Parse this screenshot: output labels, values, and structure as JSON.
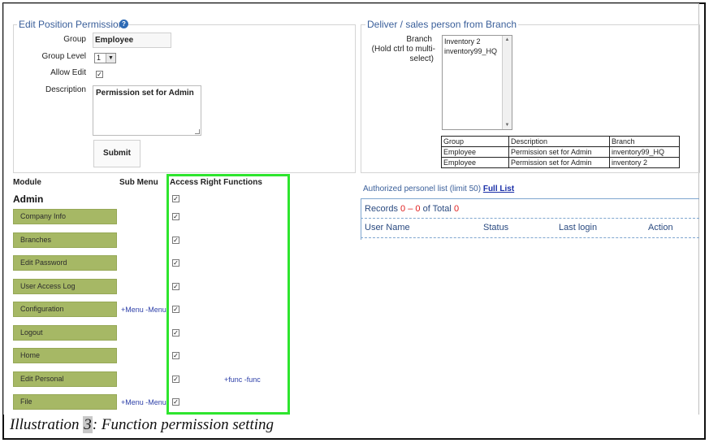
{
  "edit_position": {
    "title": "Edit Position Permission",
    "group_label": "Group",
    "group_value": "Employee",
    "group_level_label": "Group Level",
    "group_level_value": "1",
    "allow_edit_label": "Allow Edit",
    "allow_edit_checked": "✓",
    "description_label": "Description",
    "description_value": "Permission set for Admin",
    "submit_label": "Submit"
  },
  "deliver": {
    "title": "Deliver / sales person from Branch",
    "branch_label_1": "Branch",
    "branch_label_2": "(Hold ctrl to multi-",
    "branch_label_3": "select)",
    "branch_options": [
      "Inventory 2",
      "inventory99_HQ"
    ],
    "table": {
      "headers": [
        "Group",
        "Description",
        "Branch"
      ],
      "rows": [
        [
          "Employee",
          "Permission set for Admin",
          "inventory99_HQ"
        ],
        [
          "Employee",
          "Permission set for Admin",
          "inventory 2"
        ]
      ]
    }
  },
  "modules": {
    "module_header": "Module",
    "submenu_header": "Sub Menu",
    "access_header": "Access Right Functions",
    "group_name": "Admin",
    "check": "✓",
    "items": [
      {
        "label": "Company Info"
      },
      {
        "label": "Branches"
      },
      {
        "label": "Edit Password"
      },
      {
        "label": "User Access Log"
      },
      {
        "label": "Configuration",
        "submenu": "+Menu  -Menu"
      },
      {
        "label": "Logout"
      },
      {
        "label": "Home"
      },
      {
        "label": "Edit Personal",
        "func": "+func  -func"
      },
      {
        "label": "File",
        "submenu": "+Menu  -Menu"
      }
    ]
  },
  "authorized": {
    "text": "Authorized personel list (limit 50)",
    "link": "Full List",
    "records_prefix": "Records",
    "records_from": "0",
    "records_dash": "–",
    "records_to": "0",
    "records_of": "of Total",
    "records_total": "0",
    "columns": [
      "User Name",
      "Status",
      "Last login",
      "Action"
    ]
  },
  "caption": {
    "prefix": "Illustration",
    "number": "3",
    "suffix": ": Function permission setting"
  }
}
